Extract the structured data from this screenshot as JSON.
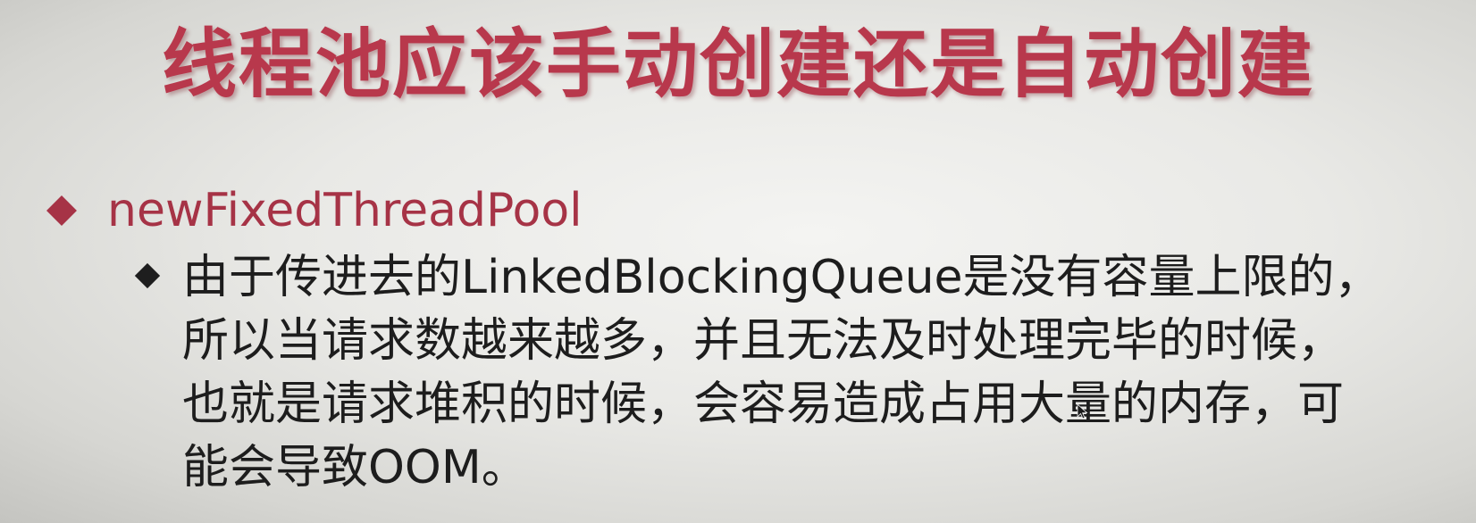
{
  "slide": {
    "title": "线程池应该手动创建还是自动创建",
    "bullet_level1": {
      "text": "newFixedThreadPool",
      "marker_color": "#a63346"
    },
    "bullet_level2": {
      "lines": [
        "由于传进去的LinkedBlockingQueue是没有容量上限的，",
        "所以当请求数越来越多，并且无法及时处理完毕的时候，",
        "也就是请求堆积的时候，会容易造成占用大量的内存，可",
        "能会导致OOM。"
      ],
      "marker_color": "#1e1e1e"
    },
    "colors": {
      "title": "#b8384c",
      "level1_text": "#a63346",
      "body_text": "#1d1d1d"
    },
    "icons": {
      "mouse_pointer": "mouse-pointer-icon"
    }
  }
}
